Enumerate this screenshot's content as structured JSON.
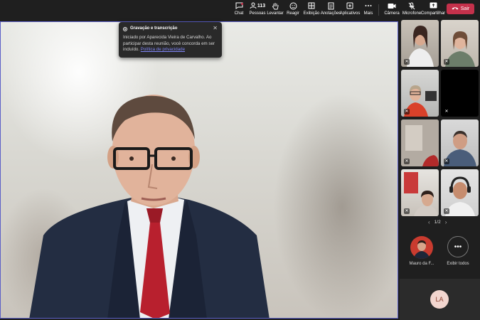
{
  "toolbar": {
    "items": [
      {
        "label": "Chat",
        "icon": "chat-icon"
      },
      {
        "label": "Pessoas",
        "icon": "people-icon",
        "count": "113"
      },
      {
        "label": "Levantar",
        "icon": "raise-hand-icon"
      },
      {
        "label": "Reagir",
        "icon": "react-icon"
      },
      {
        "label": "Exibição",
        "icon": "view-icon"
      },
      {
        "label": "Anotações",
        "icon": "notes-icon"
      },
      {
        "label": "Aplicativos",
        "icon": "apps-icon"
      },
      {
        "label": "Mais",
        "icon": "more-icon"
      },
      {
        "label": "Câmera",
        "icon": "camera-icon"
      },
      {
        "label": "Microfone",
        "icon": "mic-off-icon"
      },
      {
        "label": "Compartilhar",
        "icon": "share-icon"
      }
    ],
    "leave_label": "Sair",
    "leave_color": "#c4314b"
  },
  "notification": {
    "title": "Gravação e transcrição",
    "body": "Iniciado por Aparecida Vieira de Carvalho. Ao participar desta reunião, você concorda em ser incluído.",
    "link": "Política de privacidade"
  },
  "panel": {
    "page": "1/2",
    "pinned_name": "Mauro da F...",
    "show_all": "Exibir todos",
    "self_initials": "LA"
  },
  "accent_color": "#5b5fc7"
}
